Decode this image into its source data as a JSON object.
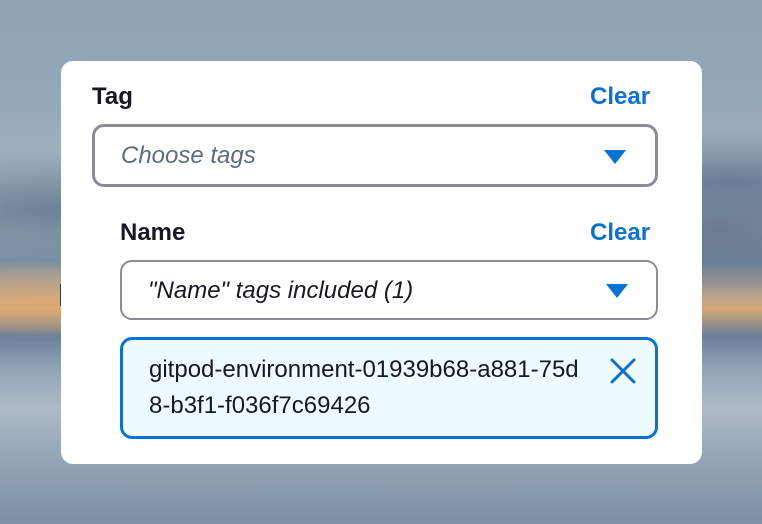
{
  "filter": {
    "tag": {
      "label": "Tag",
      "clear_label": "Clear",
      "select_placeholder": "Choose tags"
    },
    "name": {
      "label": "Name",
      "clear_label": "Clear",
      "select_value": "\"Name\" tags included (1)"
    },
    "tokens": [
      {
        "value": "gitpod-environment-01939b68-a881-75d8-b3f1-f036f7c69426"
      }
    ]
  },
  "icons": {
    "dropdown": "caret-down-icon",
    "remove": "close-icon"
  },
  "colors": {
    "accent": "#0972d3",
    "text": "#16191f",
    "placeholder": "#5f6b7a",
    "token_bg": "#f0fbff",
    "border_gray": "#8c8c94"
  }
}
